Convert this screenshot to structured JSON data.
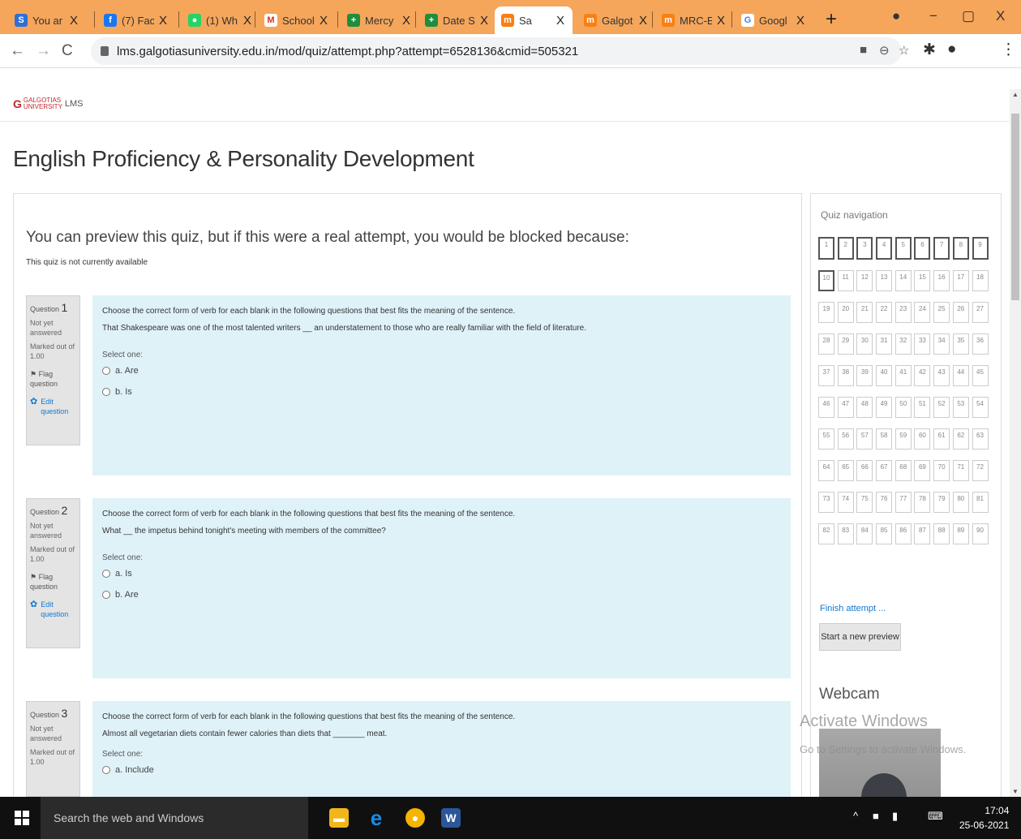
{
  "browser": {
    "tabs": [
      {
        "title": "You ar",
        "icon": "s-icon",
        "color": "#2e6fd8",
        "glyph": "S"
      },
      {
        "title": "(7) Fac",
        "icon": "facebook-icon",
        "color": "#1877f2",
        "glyph": "f"
      },
      {
        "title": "(1) Wh",
        "icon": "whatsapp-icon",
        "color": "#25d366",
        "glyph": "●"
      },
      {
        "title": "School",
        "icon": "gmail-icon",
        "color": "#ffffff",
        "glyph": "M"
      },
      {
        "title": "Mercy",
        "icon": "plus-icon",
        "color": "#1e8e3e",
        "glyph": "+"
      },
      {
        "title": "Date S",
        "icon": "plus-icon",
        "color": "#1e8e3e",
        "glyph": "+"
      },
      {
        "title": "Sa",
        "icon": "moodle-icon",
        "color": "#f98012",
        "glyph": "m"
      },
      {
        "title": "Galgot",
        "icon": "moodle-icon",
        "color": "#f98012",
        "glyph": "m"
      },
      {
        "title": "MRC-E",
        "icon": "moodle-icon",
        "color": "#f98012",
        "glyph": "m"
      },
      {
        "title": "Googl",
        "icon": "google-icon",
        "color": "#ffffff",
        "glyph": "G"
      }
    ],
    "close_glyph": "X",
    "new_tab": "+",
    "url": "lms.galgotiasuniversity.edu.in/mod/quiz/attempt.php?attempt=6528136&cmid=505321"
  },
  "lms": {
    "brand_main": "GALGOTIAS",
    "brand_sub": "UNIVERSITY",
    "brand_lms": "LMS",
    "course_title": "English Proficiency & Personality Development",
    "preview_heading": "You can preview this quiz, but if this were a real attempt, you would be blocked because:",
    "preview_reason": "This quiz is not currently available"
  },
  "questions": [
    {
      "label": "Question",
      "number": "1",
      "status": "Not yet answered",
      "marks": "Marked out of 1.00",
      "flag": "Flag question",
      "edit": "Edit question",
      "instruction": "Choose the correct form of verb for each blank in the following questions that best fits the meaning of the sentence.",
      "text": "That Shakespeare was one of the most talented writers __ an understatement to those who are really familiar with the field of literature.",
      "select": "Select one:",
      "options": [
        "a. Are",
        "b. Is"
      ]
    },
    {
      "label": "Question",
      "number": "2",
      "status": "Not yet answered",
      "marks": "Marked out of 1.00",
      "flag": "Flag question",
      "edit": "Edit question",
      "instruction": "Choose the correct form of verb for each blank in the following questions that best fits the meaning of the sentence.",
      "text": "What __ the impetus behind tonight's meeting with members of the committee?",
      "select": "Select one:",
      "options": [
        "a. Is",
        "b. Are"
      ]
    },
    {
      "label": "Question",
      "number": "3",
      "status": "Not yet answered",
      "marks": "Marked out of 1.00",
      "instruction": "Choose the correct form of verb  for each blank in the following questions that best fits the meaning of the sentence.",
      "text": "Almost all vegetarian diets contain fewer calories than diets that _______ meat.",
      "select": "Select one:",
      "options": [
        "a. Include"
      ]
    }
  ],
  "quiz_nav": {
    "title": "Quiz navigation",
    "count": 90,
    "finish": "Finish attempt ...",
    "new_preview": "Start a new preview",
    "webcam": "Webcam"
  },
  "watermark": {
    "line1": "Activate Windows",
    "line2": "Go to Settings to activate Windows."
  },
  "taskbar": {
    "search": "Search the web and Windows",
    "time": "17:04",
    "date": "25-06-2021"
  }
}
